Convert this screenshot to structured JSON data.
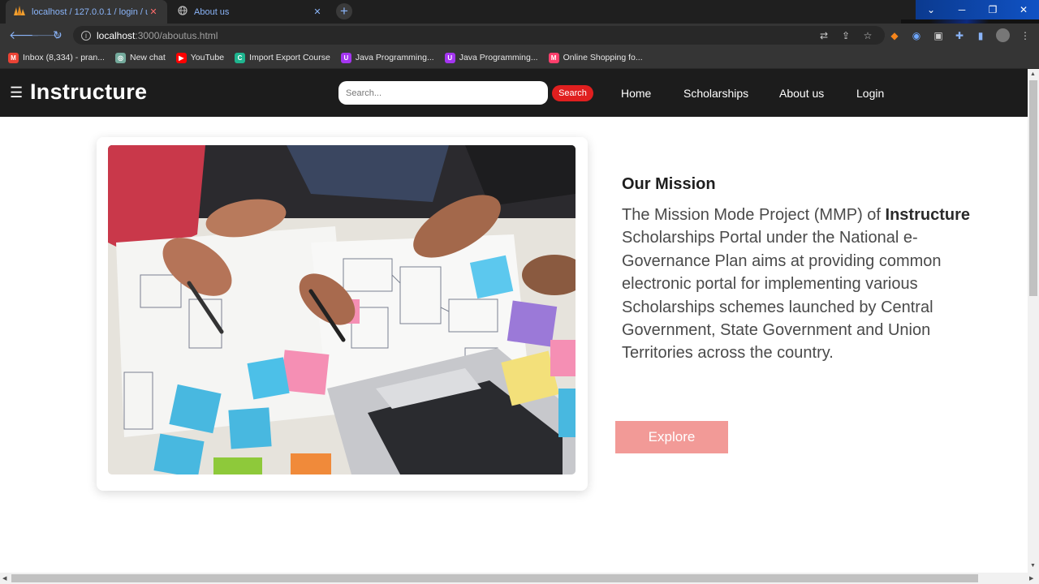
{
  "browser": {
    "tabs": [
      {
        "title": "localhost / 127.0.0.1 / login / use",
        "active": true
      },
      {
        "title": "About us",
        "active": false
      }
    ],
    "new_tab_label": "+",
    "address": {
      "host": "localhost",
      "path": ":3000/aboutus.html"
    },
    "bookmarks": [
      {
        "label": "Inbox (8,334) - pran...",
        "icon": "gmail-icon",
        "color": "#ea4335",
        "glyph": "M"
      },
      {
        "label": "New chat",
        "icon": "chatgpt-icon",
        "color": "#74aa9c",
        "glyph": "◎"
      },
      {
        "label": "YouTube",
        "icon": "youtube-icon",
        "color": "#ff0000",
        "glyph": "▶"
      },
      {
        "label": "Import Export Course",
        "icon": "course-icon",
        "color": "#1fb58f",
        "glyph": "C"
      },
      {
        "label": "Java Programming...",
        "icon": "udemy-icon",
        "color": "#a435f0",
        "glyph": "U"
      },
      {
        "label": "Java Programming...",
        "icon": "udemy-icon",
        "color": "#a435f0",
        "glyph": "U"
      },
      {
        "label": "Online Shopping fo...",
        "icon": "myntra-icon",
        "color": "#ff3f6c",
        "glyph": "M"
      }
    ]
  },
  "site": {
    "menu_glyph": "☰",
    "logo": "Instructure",
    "search_placeholder": "Search...",
    "search_button": "Search",
    "nav": [
      "Home",
      "Scholarships",
      "About us",
      "Login"
    ]
  },
  "mission": {
    "title": "Our Mission",
    "text_before": "The Mission Mode Project (MMP) of ",
    "text_bold": "Instructure",
    "text_after": " Scholarships Portal under the National e-Governance Plan aims at providing common electronic portal for implementing various Scholarships schemes launched by Central Government, State Government and Union Territories across the country.",
    "button": "Explore"
  },
  "colors": {
    "nav_bg": "#1c1c1c",
    "search_button": "#e01f1f",
    "explore_button": "#f29a97"
  }
}
